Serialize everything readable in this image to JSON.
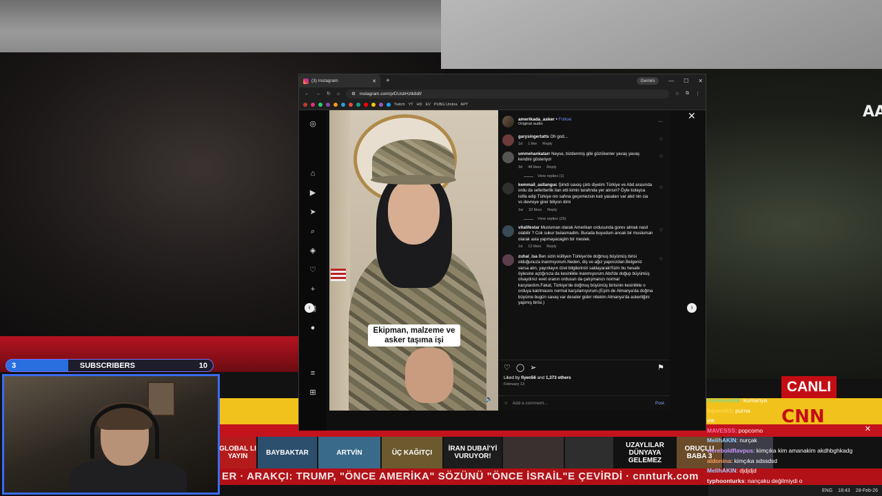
{
  "stream": {
    "subscribers_left": "3",
    "subscribers_label": "SUBSCRIBERS",
    "subscribers_right": "10",
    "news_logo": "AA",
    "cnn_canli": "CANLI",
    "cnn_logo": "CNN",
    "ticker": "ER · ARAKÇI: TRUMP, \"ÖNCE AMERİKA\" SÖZÜNÜ \"ÖNCE İSRAİL\"E ÇEVİRDİ · cnnturk.com",
    "thumbnails": [
      {
        "label": "GLOBAL LI YAYIN",
        "bg": "#b41c1c"
      },
      {
        "label": "BAYBAKTAR",
        "bg": "#2c4f6d"
      },
      {
        "label": "ARTVİN",
        "bg": "#3a6a8a"
      },
      {
        "label": "ÜÇ KAĞITÇI",
        "bg": "#6c5a2e"
      },
      {
        "label": "İRAN DUBAİ'Yİ VURUYOR!",
        "bg": "#1d1d1d"
      },
      {
        "label": "",
        "bg": "#3a3030"
      },
      {
        "label": "",
        "bg": "#2e2e2e"
      },
      {
        "label": "UZAYLILAR DÜNYAYA GELEMEZ",
        "bg": "#121212"
      },
      {
        "label": "ORUÇLU BABA 3",
        "bg": "#6a4b2a"
      },
      {
        "label": "",
        "bg": "#3d3d48"
      }
    ],
    "taskbar": {
      "lang": "ENG",
      "time": "18:43",
      "date": "28-Feb-26"
    }
  },
  "chat": {
    "messages": [
      {
        "user": "Cehennetlik",
        "text": ": kumanya",
        "color": "#7bd88f"
      },
      {
        "user": "ispanak1",
        "text": ": purna",
        "color": "#ffd54a"
      },
      {
        "user": "",
        "text": "vie",
        "color": "#ffffff"
      },
      {
        "user": "MAVESSS",
        "text": ": popcorno",
        "color": "#ff6fae"
      },
      {
        "user": "MelihAKIN",
        "text": ": nurçak",
        "color": "#9ad0ff"
      },
      {
        "user": "wereboldflavpus",
        "text": ": kimçıka kim amanakim akdhbghkadg",
        "color": "#c89bff"
      },
      {
        "user": "aldonina",
        "text": ": kimçıka sdssdsd",
        "color": "#ff9d5c"
      },
      {
        "user": "MelihAKIN",
        "text": ": djdjdjd",
        "color": "#9ad0ff"
      },
      {
        "user": "typhoonturks",
        "text": ": nançaku değilmiydi o",
        "color": "#f0f0f0"
      }
    ]
  },
  "browser": {
    "tab_title": "(3) Instagram",
    "new_tab": "+",
    "gemini": "Gemini",
    "url": "instagram.com/p/DUsbHztk8df/",
    "bookmarks": [
      "Twitch",
      "YT",
      "HD",
      "EV",
      "PUBG Umbra",
      "APT"
    ]
  },
  "post": {
    "username": "amerikada_asker",
    "follow": "Follow",
    "audio": "Original audio",
    "caption": "Ekipman, malzeme ve asker taşıma işi",
    "comments": [
      {
        "user": "garysingertatts",
        "text": "Oh god...",
        "time": "1d",
        "likes": "1 like",
        "reply": "Reply"
      },
      {
        "user": "ummehankatarr",
        "text": "Neyse, bizdenmiş gibi gözükenler yavaş yavaş kendini gösteriyor",
        "time": "3d",
        "likes": "48 likes",
        "reply": "Reply",
        "view_replies": "View replies (1)"
      },
      {
        "user": "kemmail_asllanguc",
        "text": "Şimdi savaş çıktı diyelim Türkiye ve Abd arasında ordu da seferberlik ilan etti kimin tarafında yer alırsın? Öyle kolayca istifa edip Türkiye nin safına geçemezsin katı yasaları var abd nin cia vs devreye girer biliyon dimi",
        "time": "1w",
        "likes": "32 likes",
        "reply": "Reply",
        "view_replies": "View replies (25)"
      },
      {
        "user": "vitalifestar",
        "text": "Musluman olarak Amerikan ordusunda gorev almak nasil olabilir ? Cok sukur bulasmadim. Burada buyudum ancak bir musluman olarak asla yapmayacagim bir meslek.",
        "time": "1d",
        "likes": "12 likes",
        "reply": "Reply"
      },
      {
        "user": "zuhal_isa",
        "text": "Ben sizin külliyen Türkiye'de doğmuş büyümüş birisi olduğunuza inanmıyorum.Neden, diş ve ağız yapınızdan.Belgeniz varsa alın, yayınlayın özel bilgilerinizi saklayarak!Sizin bu hesabı öylesine açtığınıza da kesinlikle inanmıyorum.Abd'de doğup büyümüş olsaydınız evet oranın ordusun da çalışmanızı normal karşılardım.Fakat, Türkiye'de doğmuş büyümüş birisinin kesinlikle o orduya katılmasını normal karşılamıyorum.(Eşim de Almanya'da doğma büyüme bugün savaş var deseler gider nitekim Almanya'da askerliğini yapmış birisi.)",
        "time": "",
        "likes": "",
        "reply": ""
      }
    ],
    "liked_by_prefix": "Liked by",
    "liked_by_user": "fiyen56",
    "liked_by_and": "and",
    "liked_by_others": "1,373 others",
    "date": "February 13",
    "add_comment_placeholder": "Add a comment...",
    "post_button": "Post"
  }
}
